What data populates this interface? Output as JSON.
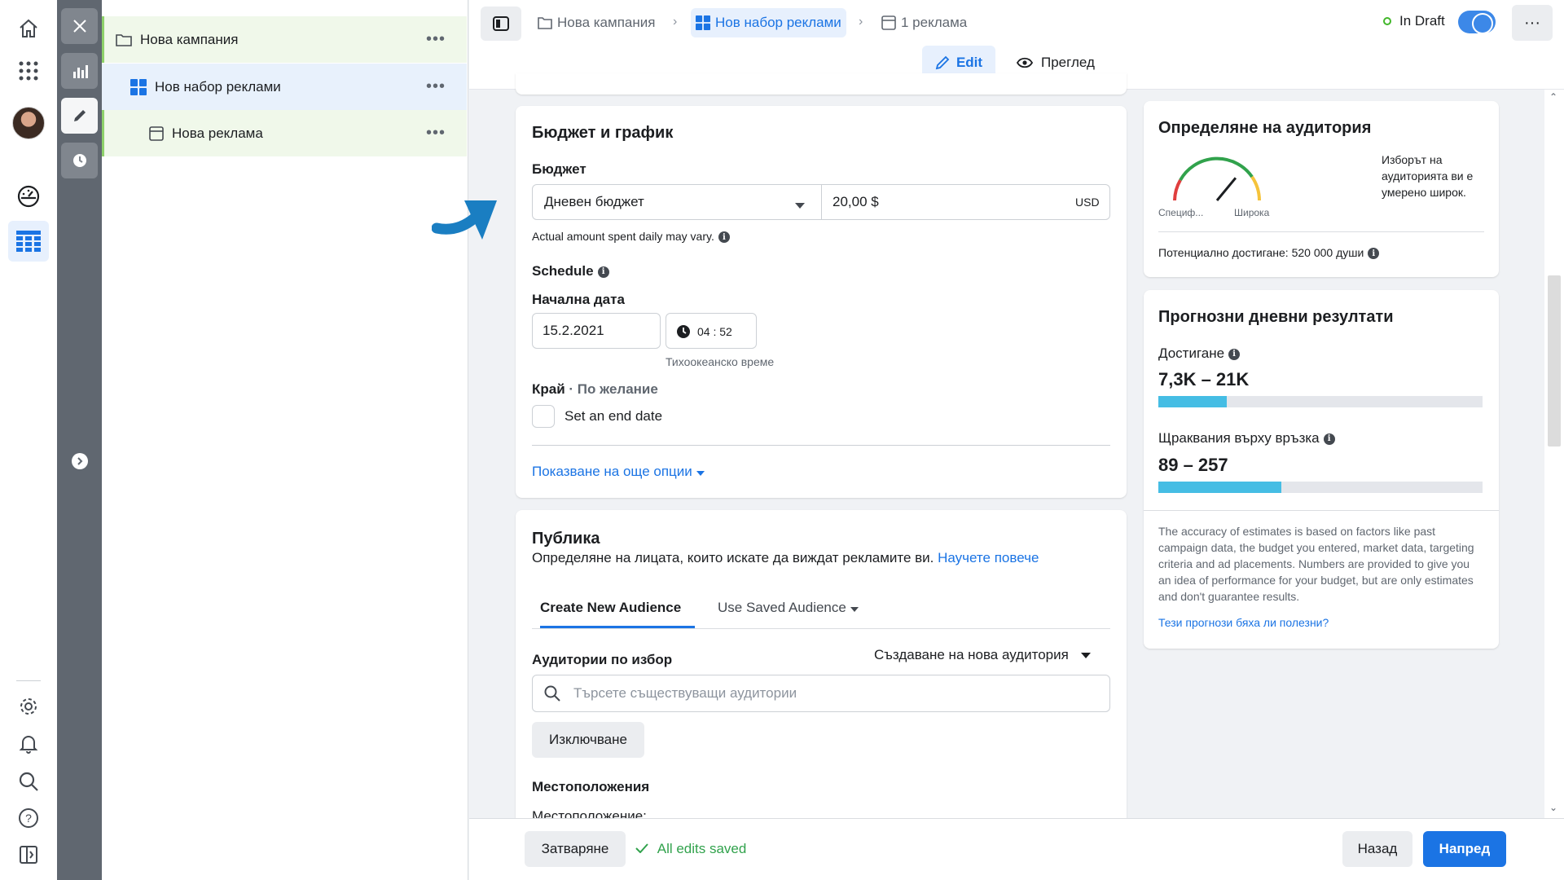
{
  "nav": {
    "rail_icons": [
      "home-icon",
      "apps-grid-icon",
      "avatar",
      "dashboard-icon",
      "ads-table-icon",
      "settings-icon",
      "bell-icon",
      "search-icon",
      "help-icon",
      "panel-icon"
    ]
  },
  "tree": {
    "items": [
      {
        "label": "Нова кампания",
        "icon": "folder-icon"
      },
      {
        "label": "Нов набор реклами",
        "icon": "grid-icon"
      },
      {
        "label": "Нова реклама",
        "icon": "ad-icon"
      }
    ]
  },
  "topbar": {
    "breadcrumbs": [
      "Нова кампания",
      "Нов набор реклами",
      "1 реклама"
    ],
    "status": "In Draft",
    "more": "···",
    "edit_label": "Edit",
    "preview_label": "Преглед"
  },
  "budget": {
    "title": "Бюджет и график",
    "budget_label": "Бюджет",
    "budget_type": "Дневен бюджет",
    "amount": "20,00 $",
    "currency": "USD",
    "note": "Actual amount spent daily may vary.",
    "schedule_label": "Schedule",
    "start_label": "Начална дата",
    "start_date": "15.2.2021",
    "start_time": "04 : 52",
    "timezone": "Тихоокеанско време",
    "end_label": "Край",
    "end_optional": "· По желание",
    "end_checkbox": "Set an end date",
    "more_options": "Показване на още опции"
  },
  "audience": {
    "title": "Публика",
    "subtitle": "Определяне на лицата, които искате да виждат рекламите ви.",
    "learn_more": "Научете повече",
    "tabs": [
      "Create New Audience",
      "Use Saved Audience"
    ],
    "custom_label": "Аудитории по избор",
    "create_new": "Създаване на нова аудитория",
    "search_placeholder": "Търсете съществуващи аудитории",
    "exclude": "Изключване",
    "locations_title": "Местоположения",
    "locations_label": "Местоположение:"
  },
  "definition": {
    "title": "Определяне на аудитория",
    "gauge_left": "Специф...",
    "gauge_right": "Широка",
    "gauge_level": 0.72,
    "description": "Изборът на аудиторията ви е умерено широк.",
    "reach": "Потенциално достигане: 520 000 души"
  },
  "forecast": {
    "title": "Прогнозни дневни резултати",
    "reach_label": "Достигане",
    "reach_value": "7,3K – 21K",
    "reach_fill": 0.21,
    "clicks_label": "Щраквания върху връзка",
    "clicks_value": "89 – 257",
    "clicks_fill": 0.38,
    "disclaimer": "The accuracy of estimates is based on factors like past campaign data, the budget you entered, market data, targeting criteria and ad placements. Numbers are provided to give you an idea of performance for your budget, but are only estimates and don't guarantee results.",
    "feedback_link": "Тези прогнози бяха ли полезни?"
  },
  "footer": {
    "close": "Затваряне",
    "saved": "All edits saved",
    "back": "Назад",
    "next": "Напред"
  },
  "colors": {
    "accent": "#1b74e4",
    "bar": "#45bde4",
    "draft_green": "#42b72a"
  }
}
